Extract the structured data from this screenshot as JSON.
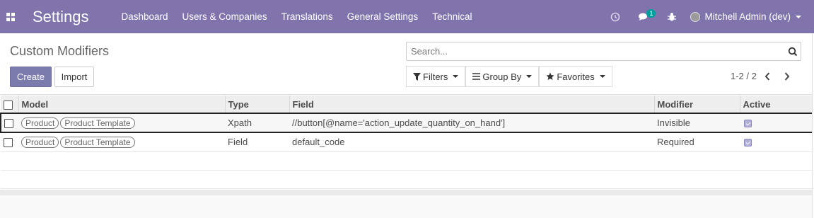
{
  "navbar": {
    "app_name": "Settings",
    "menu": [
      "Dashboard",
      "Users & Companies",
      "Translations",
      "General Settings",
      "Technical"
    ],
    "message_count": "1",
    "user": "Mitchell Admin (dev)"
  },
  "control_panel": {
    "title": "Custom Modifiers",
    "search_placeholder": "Search...",
    "create_label": "Create",
    "import_label": "Import",
    "filters_label": "Filters",
    "groupby_label": "Group By",
    "favorites_label": "Favorites",
    "pager": "1-2 / 2"
  },
  "table": {
    "columns": [
      "Model",
      "Type",
      "Field",
      "Modifier",
      "Active"
    ],
    "rows": [
      {
        "models": [
          "Product",
          "Product Template"
        ],
        "type": "Xpath",
        "field": "//button[@name='action_update_quantity_on_hand']",
        "modifier": "Invisible",
        "active": true
      },
      {
        "models": [
          "Product",
          "Product Template"
        ],
        "type": "Field",
        "field": "default_code",
        "modifier": "Required",
        "active": true
      }
    ]
  },
  "colors": {
    "navbar": "#8174ad",
    "primary_button": "#7c7bad",
    "badge": "#00a09d"
  }
}
